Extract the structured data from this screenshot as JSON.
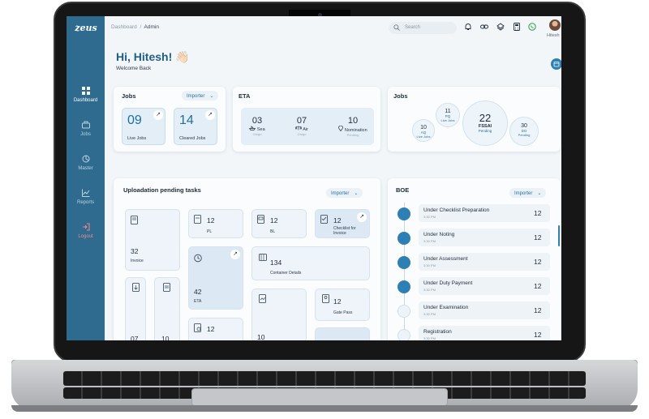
{
  "sidebar": {
    "logo": "zeus",
    "items": [
      {
        "label": "Dashboard",
        "icon": "dashboard-icon",
        "active": true
      },
      {
        "label": "Jobs",
        "icon": "briefcase-icon"
      },
      {
        "label": "Master",
        "icon": "master-icon"
      },
      {
        "label": "Reports",
        "icon": "chart-icon"
      },
      {
        "label": "Logout",
        "icon": "logout-icon"
      }
    ]
  },
  "header": {
    "breadcrumb_root": "Dashboard",
    "breadcrumb_sep": "/",
    "breadcrumb_current": "Admin",
    "search_placeholder": "Search",
    "user_name": "Hitesh"
  },
  "greeting": {
    "title": "Hi, Hitesh! 👋🏻",
    "subtitle": "Welcome Back"
  },
  "jobs_card": {
    "title": "Jobs",
    "filter": "Importer",
    "live": {
      "value": "09",
      "label": "Live Jobs"
    },
    "cleared": {
      "value": "14",
      "label": "Cleared Jobs"
    }
  },
  "eta_card": {
    "title": "ETA",
    "items": [
      {
        "value": "03",
        "label": "Sea",
        "sub": "Cargo"
      },
      {
        "value": "07",
        "label": "Air",
        "sub": "Cargo"
      },
      {
        "value": "10",
        "label": "Nomination",
        "sub": "Pending"
      }
    ]
  },
  "jobs_summary": {
    "title": "Jobs",
    "bubbles": [
      {
        "value": "10",
        "code": "AQ",
        "label": "Live Jobs"
      },
      {
        "value": "11",
        "code": "PQ",
        "label": "Live Jobs"
      },
      {
        "value": "22",
        "code": "FSSAI",
        "label": "Pending"
      },
      {
        "value": "30",
        "code": "DO",
        "label": "Pending"
      }
    ]
  },
  "uploads": {
    "title": "Uploadation pending tasks",
    "filter": "Importer",
    "tiles": {
      "invoice": {
        "value": "32",
        "label": "Invoice"
      },
      "pl": {
        "value": "12",
        "label": "PL"
      },
      "bl": {
        "value": "12",
        "label": "BL"
      },
      "checklist": {
        "value": "12",
        "label": "Checklist for Invoice"
      },
      "eta": {
        "value": "42",
        "label": "ETA"
      },
      "container": {
        "value": "134",
        "label": "Container Details"
      },
      "gatepass": {
        "value": "12",
        "label": "Gate Pass"
      },
      "a": {
        "value": "07"
      },
      "b": {
        "value": "10"
      },
      "c": {
        "value": "12"
      }
    }
  },
  "boe": {
    "title": "BOE",
    "filter": "Importer",
    "rows": [
      {
        "label": "Under Checklist Preparation",
        "time": "3:30 PM",
        "value": "12"
      },
      {
        "label": "Under Noting",
        "time": "3:30 PM",
        "value": "12"
      },
      {
        "label": "Under Assessment",
        "time": "3:30 PM",
        "value": "12"
      },
      {
        "label": "Under Duty Payment",
        "time": "3:30 PM",
        "value": "12"
      },
      {
        "label": "Under Examination",
        "time": "3:30 PM",
        "value": "12"
      },
      {
        "label": "Registration",
        "time": "3:30 PM",
        "value": "12"
      }
    ]
  },
  "colors": {
    "sidebar": "#2e6b8f",
    "accent": "#2e7fb3",
    "title": "#1f5f87"
  }
}
